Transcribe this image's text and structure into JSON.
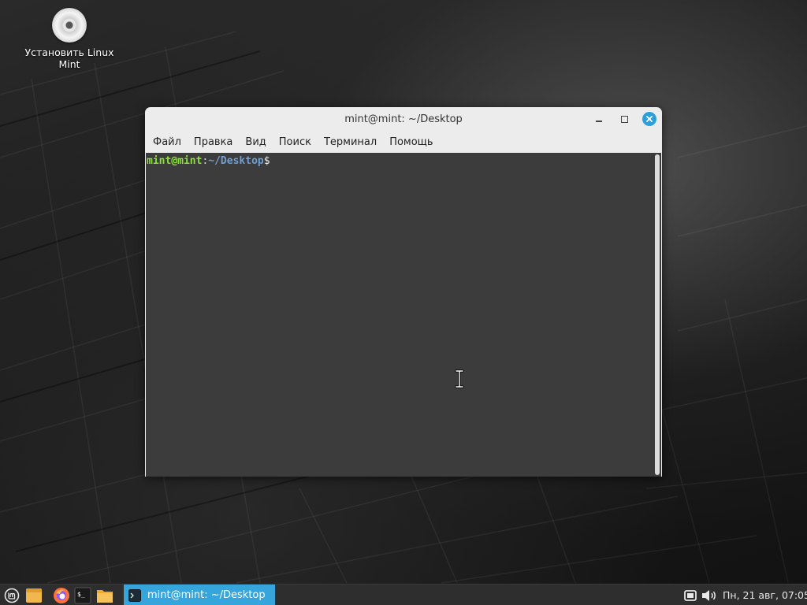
{
  "desktop": {
    "icons": [
      {
        "label": "Установить Linux Mint",
        "icon": "disc-icon"
      }
    ]
  },
  "window": {
    "title": "mint@mint: ~/Desktop",
    "controls": [
      "minimize-icon",
      "maximize-icon",
      "close-icon"
    ],
    "accent": "#2d9fd8",
    "menu": [
      "Файл",
      "Правка",
      "Вид",
      "Поиск",
      "Терминал",
      "Помощь"
    ],
    "terminal": {
      "prompt_user": "mint@mint",
      "prompt_colon": ":",
      "prompt_path": "~/Desktop",
      "prompt_symbol": "$",
      "colors": {
        "user": "#8ae234",
        "path": "#729fcf",
        "background": "#3c3c3c"
      }
    }
  },
  "taskbar": {
    "launchers": [
      "linux-mint-menu-icon",
      "files-icon",
      "firefox-icon",
      "terminal-icon",
      "folder-icon"
    ],
    "tasks": [
      {
        "label": "mint@mint: ~/Desktop",
        "icon": "terminal-icon",
        "active": true
      }
    ],
    "tray": [
      "network-icon",
      "volume-icon"
    ],
    "clock": "Пн, 21 авг, 07:05",
    "accent": "#35a5db"
  }
}
